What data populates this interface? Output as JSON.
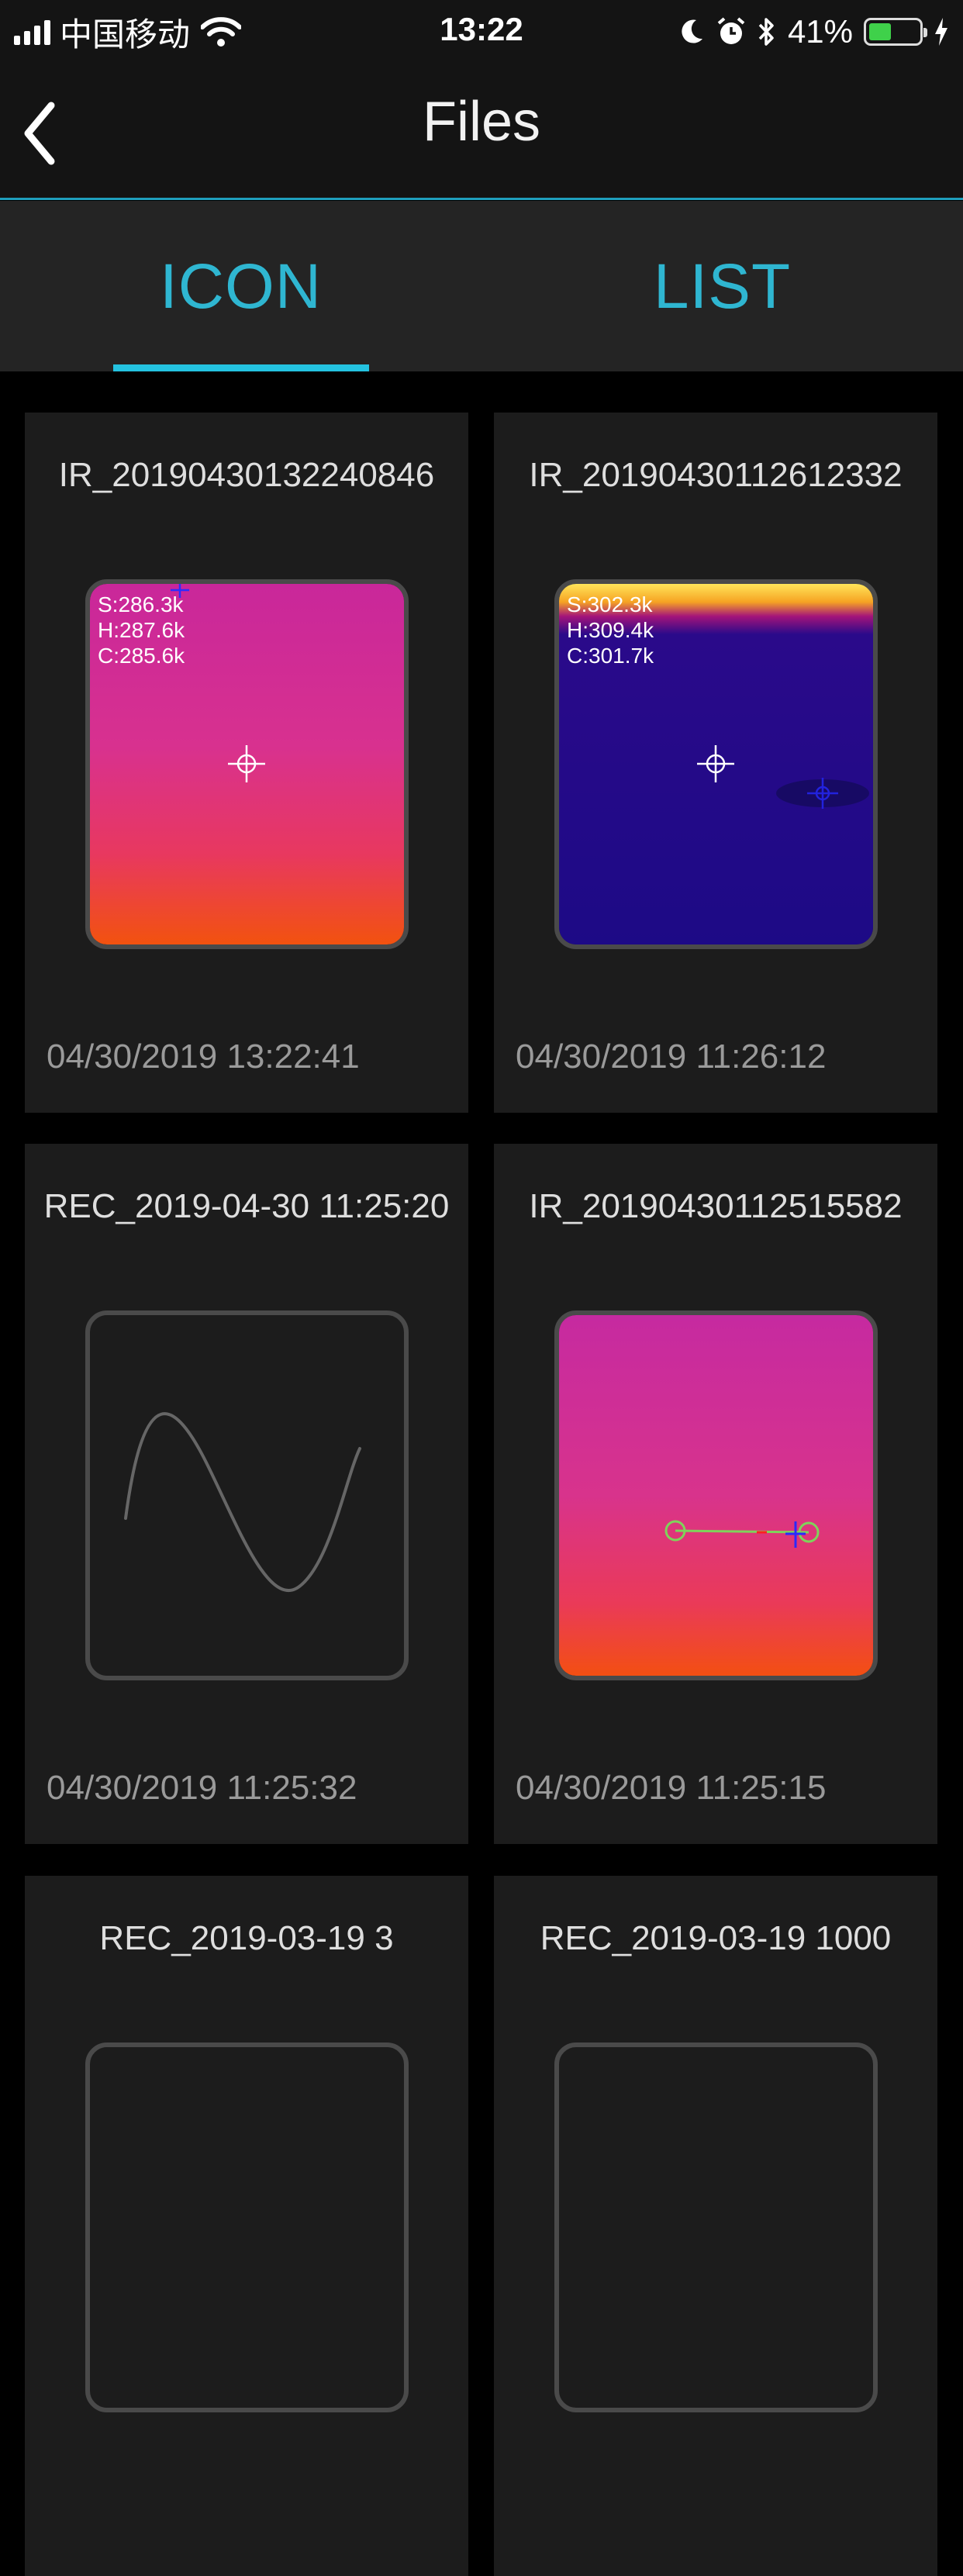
{
  "status": {
    "carrier": "中国移动",
    "time": "13:22",
    "battery": "41%",
    "battery_level": 0.41
  },
  "nav": {
    "title": "Files",
    "back_icon": "chevron-left-icon"
  },
  "tabs": [
    {
      "label": "ICON",
      "active": true
    },
    {
      "label": "LIST",
      "active": false
    }
  ],
  "colors": {
    "accent": "#24c2e0",
    "tab_text": "#2fb6d1",
    "card_bg": "#1c1c1c",
    "battery_green": "#3fd14a"
  },
  "files": [
    {
      "name": "IR_20190430132240846",
      "date": "04/30/2019 13:22:41",
      "type": "thermal",
      "readings": [
        "S:286.3k",
        "H:287.6k",
        "C:285.6k"
      ]
    },
    {
      "name": "IR_20190430112612332",
      "date": "04/30/2019 11:26:12",
      "type": "thermal",
      "readings": [
        "S:302.3k",
        "H:309.4k",
        "C:301.7k"
      ]
    },
    {
      "name": "REC_2019-04-30 11:25:20",
      "date": "04/30/2019 11:25:32",
      "type": "recording"
    },
    {
      "name": "IR_20190430112515582",
      "date": "04/30/2019 11:25:15",
      "type": "thermal"
    },
    {
      "name": "REC_2019-03-19 3",
      "date": "",
      "type": "recording"
    },
    {
      "name": "REC_2019-03-19 1000",
      "date": "",
      "type": "recording"
    }
  ]
}
